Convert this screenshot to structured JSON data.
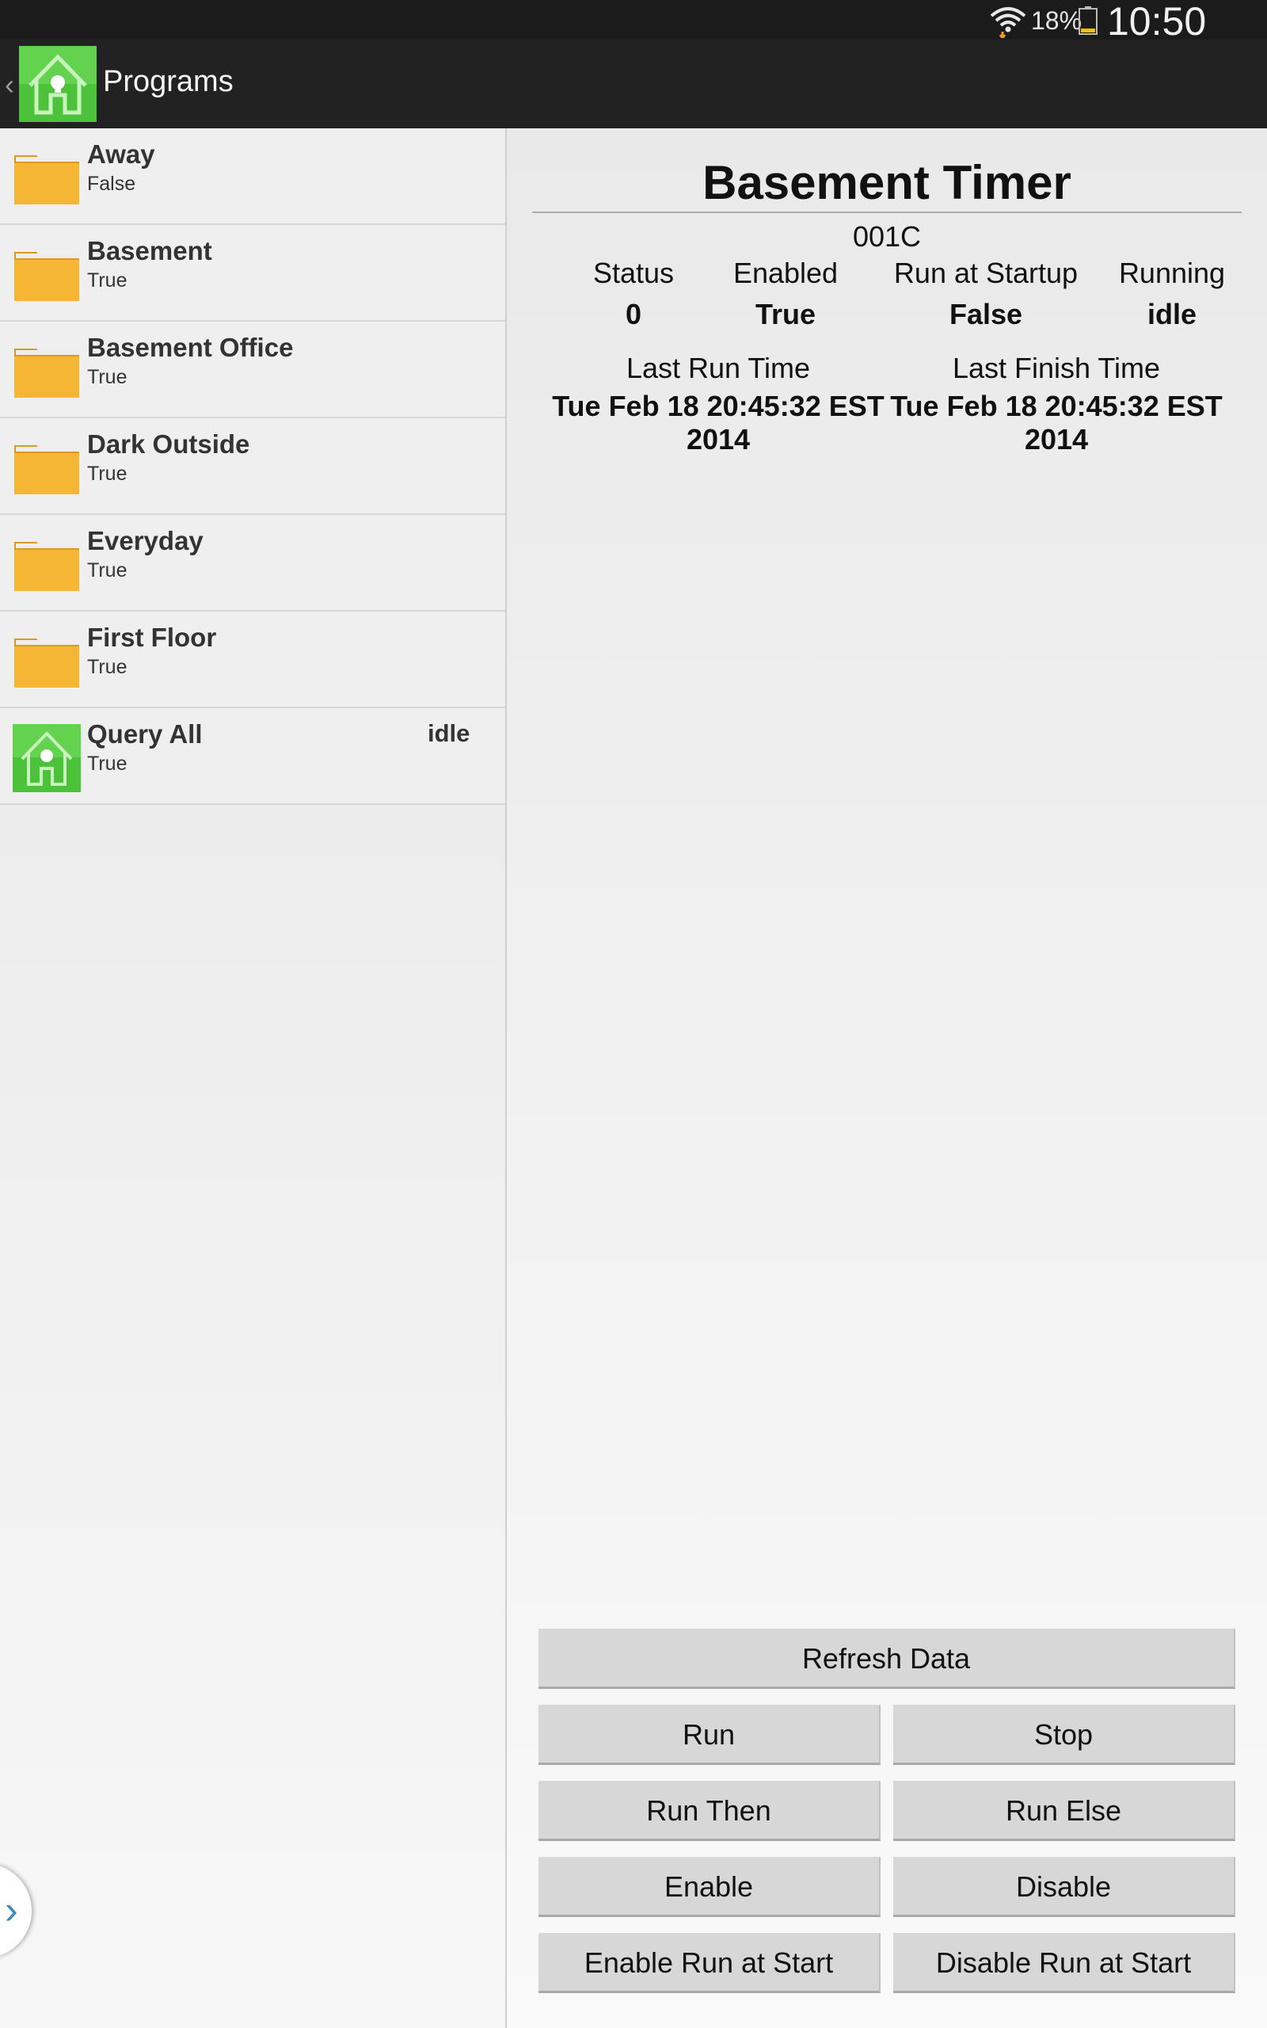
{
  "status_bar": {
    "battery": "18%",
    "time": "10:50 PM"
  },
  "action_bar": {
    "title": "Programs"
  },
  "list": [
    {
      "name": "Away",
      "sub": "False",
      "icon": "folder-icon",
      "status": ""
    },
    {
      "name": "Basement",
      "sub": "True",
      "icon": "folder-icon",
      "status": ""
    },
    {
      "name": "Basement Office",
      "sub": "True",
      "icon": "folder-icon",
      "status": ""
    },
    {
      "name": "Dark Outside",
      "sub": "True",
      "icon": "folder-icon",
      "status": ""
    },
    {
      "name": "Everyday",
      "sub": "True",
      "icon": "folder-icon",
      "status": ""
    },
    {
      "name": "First Floor",
      "sub": "True",
      "icon": "folder-icon",
      "status": ""
    },
    {
      "name": "Query All",
      "sub": "True",
      "icon": "program-house-icon",
      "status": "idle"
    }
  ],
  "detail": {
    "title": "Basement Timer",
    "id": "001C",
    "fields": [
      {
        "label": "Status",
        "value": "0"
      },
      {
        "label": "Enabled",
        "value": "True"
      },
      {
        "label": "Run at Startup",
        "value": "False"
      },
      {
        "label": "Running",
        "value": "idle"
      }
    ],
    "last_run_label": "Last Run Time",
    "last_run_value": "Tue Feb 18 20:45:32 EST 2014",
    "last_finish_label": "Last Finish Time",
    "last_finish_value": "Tue Feb 18 20:45:32 EST 2014"
  },
  "buttons": {
    "refresh": "Refresh Data",
    "run": "Run",
    "stop": "Stop",
    "run_then": "Run Then",
    "run_else": "Run Else",
    "enable": "Enable",
    "disable": "Disable",
    "enable_run_at_start": "Enable Run at Start",
    "disable_run_at_start": "Disable Run at Start"
  },
  "colors": {
    "action_bar": "#222222",
    "status_bar": "#1b1b1b",
    "folder": "#f4b634",
    "logo_green": "#4cc23a",
    "button": "#d7d7d7"
  }
}
